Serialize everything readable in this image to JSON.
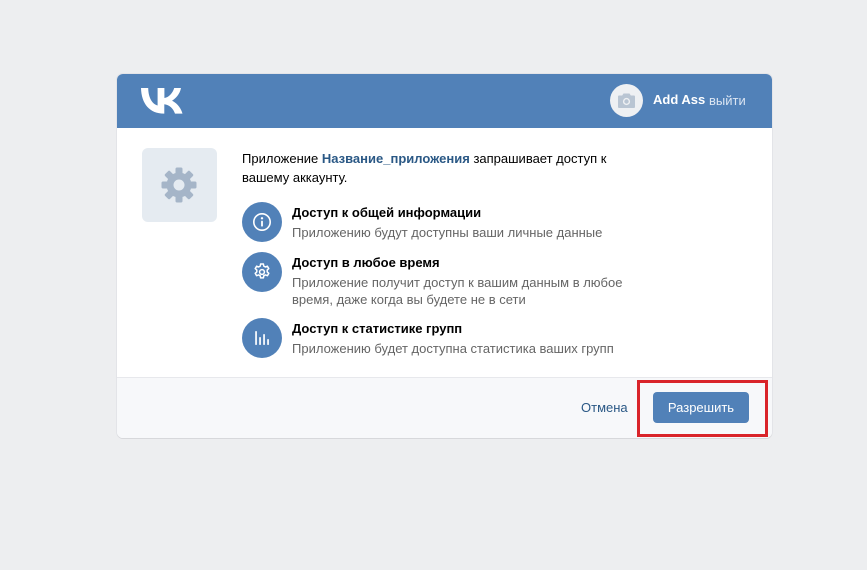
{
  "header": {
    "logo": "vk-logo",
    "user_name": "Add Ass",
    "logout_label": "выйти",
    "background_color": "#5181b8"
  },
  "request": {
    "prefix": "Приложение ",
    "app_name": "Название_приложения",
    "suffix": " запрашивает доступ к вашему аккаунту."
  },
  "permissions": [
    {
      "icon": "info-icon",
      "title": "Доступ к общей информации",
      "description": "Приложению будут доступны ваши личные данные"
    },
    {
      "icon": "gear-icon",
      "title": "Доступ в любое время",
      "description": "Приложение получит доступ к вашим данным в любое время, даже когда вы будете не в сети"
    },
    {
      "icon": "stats-icon",
      "title": "Доступ к статистике групп",
      "description": "Приложению будет доступна статистика ваших групп"
    }
  ],
  "footer": {
    "cancel_label": "Отмена",
    "allow_label": "Разрешить"
  },
  "colors": {
    "accent": "#5181b8",
    "link": "#2a5885",
    "highlight": "#d9242a",
    "page_background": "#edeef0"
  }
}
